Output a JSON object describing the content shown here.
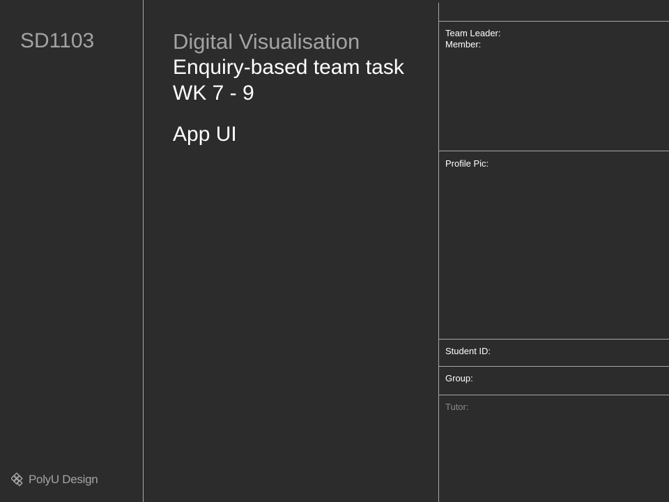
{
  "left_panel": {
    "course_code": "SD1103",
    "logo_text": "PolyU Design"
  },
  "center_panel": {
    "subject": "Digital Visualisation",
    "task_line_1": "Enquiry-based team task",
    "task_line_2": "WK 7 - 9",
    "project_title": "App UI"
  },
  "info_panel": {
    "team_leader_label": "Team Leader:",
    "member_label": "Member:",
    "profile_pic_label": "Profile Pic:",
    "student_id_label": "Student ID:",
    "group_label": "Group:",
    "tutor_label": "Tutor:"
  },
  "colors": {
    "background": "#2c2c2c",
    "muted_text": "#a3a3a3",
    "text": "#ffffff",
    "divider": "#a8a8a8"
  }
}
